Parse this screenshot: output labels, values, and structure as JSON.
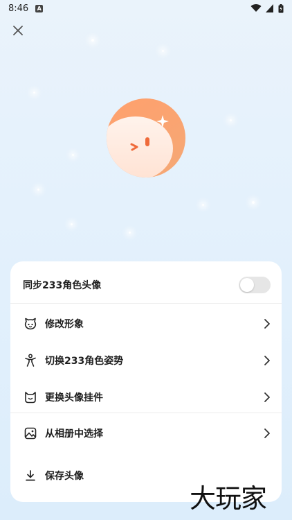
{
  "status_bar": {
    "time": "8:46",
    "notification_icon": "A"
  },
  "sync_row": {
    "label": "同步233角色头像",
    "toggle_on": false
  },
  "menu": {
    "items": [
      {
        "label": "修改形象",
        "icon": "face-icon"
      },
      {
        "label": "切换233角色姿势",
        "icon": "figure-icon"
      },
      {
        "label": "更换头像挂件",
        "icon": "pendant-icon"
      },
      {
        "label": "从相册中选择",
        "icon": "photo-icon"
      },
      {
        "label": "保存头像",
        "icon": "download-icon"
      }
    ]
  },
  "watermark": "大玩家",
  "colors": {
    "accent": "#f99a63",
    "background": "#e4f1fc"
  }
}
